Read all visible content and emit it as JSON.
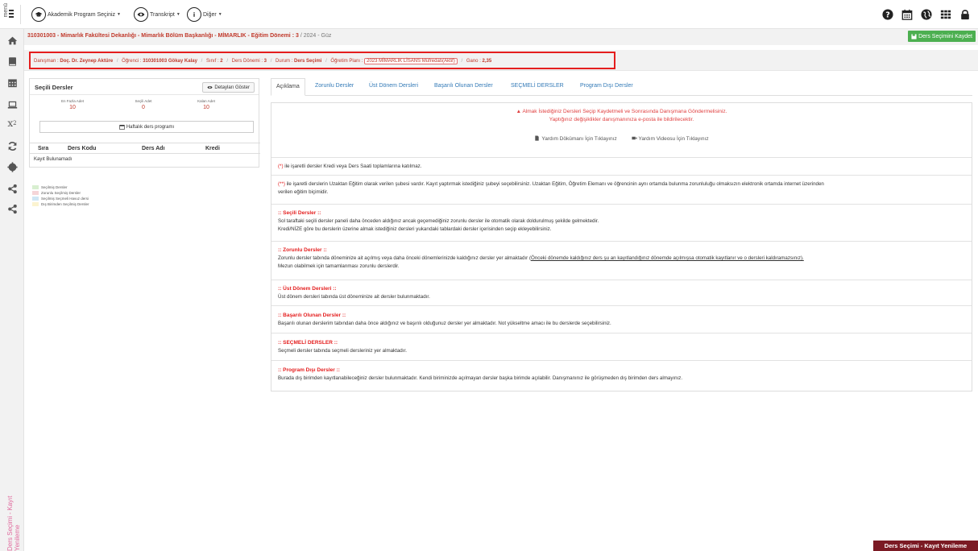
{
  "topbar": {
    "menu_label": "menü",
    "nav": [
      {
        "label": "Akademik Program Seçiniz",
        "icon": "graduation-cap-icon"
      },
      {
        "label": "Transkript",
        "icon": "eye-icon"
      },
      {
        "label": "Diğer",
        "icon": "info-icon"
      }
    ],
    "right_icons": [
      "question-icon",
      "calendar-icon",
      "globe-icon",
      "grid-icon",
      "lock-icon"
    ]
  },
  "breadcrumb": {
    "path": "310301003 - Mimarlık Fakültesi Dekanlığı - Mimarlık Bölüm Başkanlığı - MİMARLIK - Eğitim Dönemi : 3",
    "term": "2024 - Güz"
  },
  "save_button": "Ders Seçimini Kaydet",
  "info": {
    "advisor_label": "Danışman :",
    "advisor": "Doç. Dr. Zeynep Aktüre",
    "student_label": "Öğrenci :",
    "student": "310301003 Gökay Kalay",
    "class_label": "Sınıf :",
    "class": "2",
    "term_label": "Ders Dönemi :",
    "term": "3",
    "status_label": "Durum :",
    "status": "Ders Seçimi",
    "plan_label": "Öğretim Planı :",
    "plan": "2023 MİMARLIK LİSANS Müfredatı(Aktif)",
    "gpa_label": "Gano :",
    "gpa": "2,35"
  },
  "left_panel": {
    "title": "Seçili Dersler",
    "detail_button": "Detayları Göster",
    "stats": [
      {
        "label": "En Fazla Adet",
        "value": "10"
      },
      {
        "label": "Seçili Adet",
        "value": "0"
      },
      {
        "label": "Kalan Adet",
        "value": "10"
      }
    ],
    "weekly_button": "Haftalık ders programı",
    "columns": [
      "Sıra",
      "Ders Kodu",
      "Ders Adı",
      "Kredi"
    ],
    "no_records": "Kayıt Bulunamadı"
  },
  "legend": [
    {
      "label": "Seçilmiş Dersler",
      "color": "#d8efd0"
    },
    {
      "label": "Zorunlu Seçilmiş Dersler",
      "color": "#f5d5d8"
    },
    {
      "label": "Seçilmiş Seçmeli Havuz dersi",
      "color": "#cfe6f5"
    },
    {
      "label": "Dış Birimden Seçilmiş Dersler",
      "color": "#fbf3d0"
    }
  ],
  "tabs": [
    "Açıklama",
    "Zorunlu Dersler",
    "Üst Dönem Dersleri",
    "Başarılı Olunan Dersler",
    "SEÇMELİ DERSLER",
    "Program Dışı Dersler"
  ],
  "content": {
    "warning_line1": "Almak İstediğiniz Dersleri Seçip Kaydetmeli ve Sonrasında Danışmana Göndermelisiniz.",
    "warning_line2": "Yaptığınız değişiklikler danışmanınıza e-posta ile bildirilecektir.",
    "help_doc": "Yardım Dökümanı İçin Tıklayınız",
    "help_video": "Yardım Videosu İçin Tıklayınız",
    "note1_mark": "(*)",
    "note1": " ile işaretli dersler Kredi veya Ders Saati toplamlarına katılmaz.",
    "note2_mark": "(**)",
    "note2_l1": " ile işaretli derslerin Uzaktan Eğitim olarak verilen şubesi vardır. Kayıt yaptırmak istediğiniz şubeyi seçebilirsiniz. Uzaktan Eğitim, Öğretim Elemanı ve öğrencinin aynı ortamda bulunma zorunluluğu olmaksızın elektronik ortamda internet üzerinden",
    "note2_l2": "verilen eğitim biçimidir.",
    "s1_title": ":: Seçili Dersler ::",
    "s1_l1": "Sol taraftaki seçili dersler paneli daha önceden aldığınız ancak geçemediğiniz zorunlu dersler ile otomatik olarak doldurulmuş şekilde gelmektedir.",
    "s1_l2": "Kredi/NİZE göre bu derslerin üzerine almak istediğiniz dersleri yukarıdaki tablardaki dersler içerisinden seçip ekleyebilirsiniz.",
    "s2_title": ":: Zorunlu Dersler ::",
    "s2_l1a": "Zorunlu dersler tabında döneminize ait açılmış veya daha önceki dönemlerinizde kaldığınız dersler yer almaktadır (",
    "s2_l1b": "Önceki dönemde kaldığınız ders şu an kayıtlandığınız dönemde açılmışsa otomatik kayıtlanır ve o dersleri kaldıramazsınız).",
    "s2_l2": "Mezun olabilmek için tamamlanması zorunlu derslerdir.",
    "s3_title": ":: Üst Dönem Dersleri ::",
    "s3_l1": "Üst dönem dersleri tabında üst döneminize ait dersler bulunmaktadır.",
    "s4_title": ":: Başarılı Olunan Dersler ::",
    "s4_l1": "Başarılı olunan derslerim tabından daha önce aldığınız ve başırılı olduğunuz dersler yer almaktadır. Not yükseltme amacı ile bu derslerde seçebilirsiniz.",
    "s5_title": ":: SEÇMELİ DERSLER ::",
    "s5_l1": "Seçmeli dersler tabında seçmeli dersleriniz yer almaktadır.",
    "s6_title": ":: Program Dışı Dersler ::",
    "s6_l1": "Burada dış birimden kayıtlanabileceğiniz dersler bulunmaktadır. Kendi biriminizde açılmayan dersler başka birimde açılabilir. Danışmanınız ile görüşmeden dış birimden ders almayınız."
  },
  "side_title": "Ders Seçimi - Kayıt Yenileme",
  "footer_tag": "Ders Seçimi - Kayıt Yenileme"
}
